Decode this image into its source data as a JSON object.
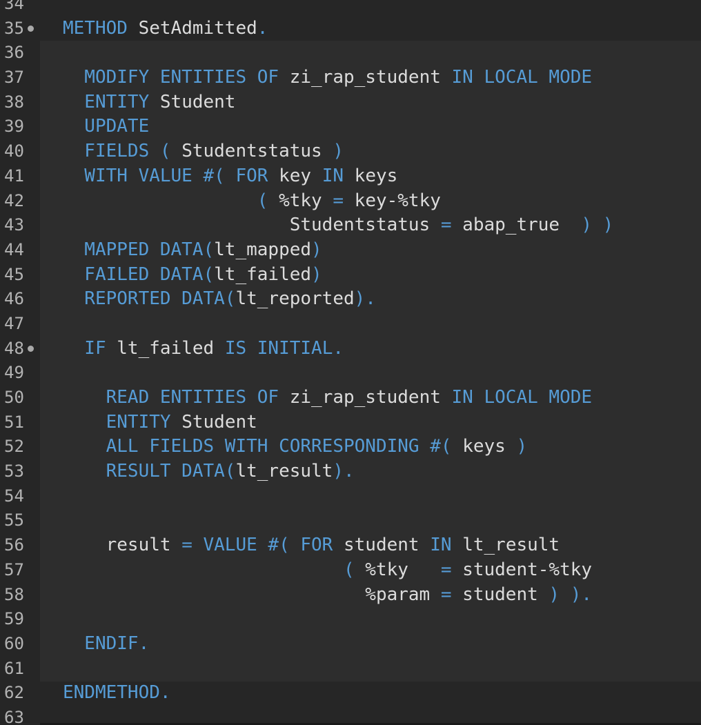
{
  "editor": {
    "lines": [
      {
        "number": "34",
        "fold": false,
        "tokens": []
      },
      {
        "number": "35",
        "fold": true,
        "tokens": [
          {
            "t": "METHOD",
            "c": "kw"
          },
          {
            "t": " SetAdmitted",
            "c": "id"
          },
          {
            "t": ".",
            "c": "op"
          }
        ]
      },
      {
        "number": "36",
        "fold": false,
        "tokens": []
      },
      {
        "number": "37",
        "fold": false,
        "tokens": [
          {
            "t": "  MODIFY ENTITIES OF",
            "c": "kw"
          },
          {
            "t": " zi_rap_student ",
            "c": "id"
          },
          {
            "t": "IN LOCAL MODE",
            "c": "kw"
          }
        ]
      },
      {
        "number": "38",
        "fold": false,
        "tokens": [
          {
            "t": "  ENTITY",
            "c": "kw"
          },
          {
            "t": " Student",
            "c": "id"
          }
        ]
      },
      {
        "number": "39",
        "fold": false,
        "tokens": [
          {
            "t": "  UPDATE",
            "c": "kw"
          }
        ]
      },
      {
        "number": "40",
        "fold": false,
        "tokens": [
          {
            "t": "  FIELDS ( ",
            "c": "kw"
          },
          {
            "t": "Studentstatus",
            "c": "id"
          },
          {
            "t": " )",
            "c": "op"
          }
        ]
      },
      {
        "number": "41",
        "fold": false,
        "tokens": [
          {
            "t": "  WITH VALUE #( FOR",
            "c": "kw"
          },
          {
            "t": " key ",
            "c": "id"
          },
          {
            "t": "IN",
            "c": "kw"
          },
          {
            "t": " keys",
            "c": "id"
          }
        ]
      },
      {
        "number": "42",
        "fold": false,
        "tokens": [
          {
            "t": "                  ( ",
            "c": "op"
          },
          {
            "t": "%tky ",
            "c": "id"
          },
          {
            "t": "=",
            "c": "op"
          },
          {
            "t": " key-%tky",
            "c": "id"
          }
        ]
      },
      {
        "number": "43",
        "fold": false,
        "tokens": [
          {
            "t": "                     Studentstatus ",
            "c": "id"
          },
          {
            "t": "=",
            "c": "op"
          },
          {
            "t": " abap_true  ",
            "c": "id"
          },
          {
            "t": ") )",
            "c": "op"
          }
        ]
      },
      {
        "number": "44",
        "fold": false,
        "tokens": [
          {
            "t": "  MAPPED DATA(",
            "c": "kw"
          },
          {
            "t": "lt_mapped",
            "c": "id"
          },
          {
            "t": ")",
            "c": "op"
          }
        ]
      },
      {
        "number": "45",
        "fold": false,
        "tokens": [
          {
            "t": "  FAILED DATA(",
            "c": "kw"
          },
          {
            "t": "lt_failed",
            "c": "id"
          },
          {
            "t": ")",
            "c": "op"
          }
        ]
      },
      {
        "number": "46",
        "fold": false,
        "tokens": [
          {
            "t": "  REPORTED DATA(",
            "c": "kw"
          },
          {
            "t": "lt_reported",
            "c": "id"
          },
          {
            "t": ").",
            "c": "op"
          }
        ]
      },
      {
        "number": "47",
        "fold": false,
        "tokens": []
      },
      {
        "number": "48",
        "fold": true,
        "tokens": [
          {
            "t": "  IF",
            "c": "kw"
          },
          {
            "t": " lt_failed ",
            "c": "id"
          },
          {
            "t": "IS INITIAL.",
            "c": "kw"
          }
        ]
      },
      {
        "number": "49",
        "fold": false,
        "tokens": []
      },
      {
        "number": "50",
        "fold": false,
        "tokens": [
          {
            "t": "    READ ENTITIES OF",
            "c": "kw"
          },
          {
            "t": " zi_rap_student ",
            "c": "id"
          },
          {
            "t": "IN LOCAL MODE",
            "c": "kw"
          }
        ]
      },
      {
        "number": "51",
        "fold": false,
        "tokens": [
          {
            "t": "    ENTITY",
            "c": "kw"
          },
          {
            "t": " Student",
            "c": "id"
          }
        ]
      },
      {
        "number": "52",
        "fold": false,
        "tokens": [
          {
            "t": "    ALL FIELDS WITH CORRESPONDING #( ",
            "c": "kw"
          },
          {
            "t": "keys",
            "c": "id"
          },
          {
            "t": " )",
            "c": "op"
          }
        ]
      },
      {
        "number": "53",
        "fold": false,
        "tokens": [
          {
            "t": "    RESULT DATA(",
            "c": "kw"
          },
          {
            "t": "lt_result",
            "c": "id"
          },
          {
            "t": ").",
            "c": "op"
          }
        ]
      },
      {
        "number": "54",
        "fold": false,
        "tokens": []
      },
      {
        "number": "55",
        "fold": false,
        "tokens": []
      },
      {
        "number": "56",
        "fold": false,
        "tokens": [
          {
            "t": "    result ",
            "c": "id"
          },
          {
            "t": "= VALUE #( FOR",
            "c": "kw"
          },
          {
            "t": " student ",
            "c": "id"
          },
          {
            "t": "IN",
            "c": "kw"
          },
          {
            "t": " lt_result",
            "c": "id"
          }
        ]
      },
      {
        "number": "57",
        "fold": false,
        "tokens": [
          {
            "t": "                          ( ",
            "c": "op"
          },
          {
            "t": "%tky   ",
            "c": "id"
          },
          {
            "t": "=",
            "c": "op"
          },
          {
            "t": " student-%tky",
            "c": "id"
          }
        ]
      },
      {
        "number": "58",
        "fold": false,
        "tokens": [
          {
            "t": "                            %param ",
            "c": "id"
          },
          {
            "t": "=",
            "c": "op"
          },
          {
            "t": " student ",
            "c": "id"
          },
          {
            "t": ") ).",
            "c": "op"
          }
        ]
      },
      {
        "number": "59",
        "fold": false,
        "tokens": []
      },
      {
        "number": "60",
        "fold": false,
        "tokens": [
          {
            "t": "  ENDIF.",
            "c": "kw"
          }
        ]
      },
      {
        "number": "61",
        "fold": false,
        "tokens": []
      },
      {
        "number": "62",
        "fold": false,
        "tokens": [
          {
            "t": "ENDMETHOD.",
            "c": "kw"
          }
        ]
      },
      {
        "number": "63",
        "fold": false,
        "tokens": []
      }
    ]
  }
}
